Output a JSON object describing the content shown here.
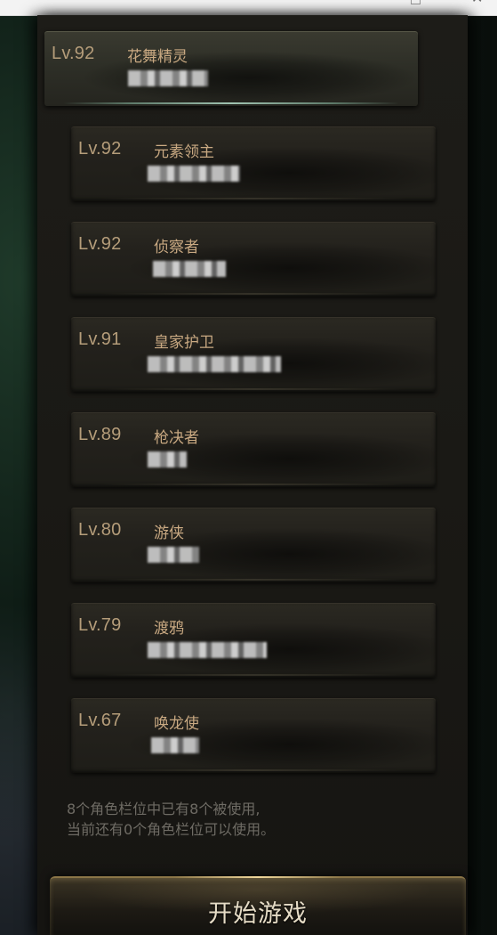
{
  "window": {
    "maximize_icon": "maximize-icon",
    "close_icon": "close-icon",
    "close_glyph": "✕"
  },
  "characters": [
    {
      "level": "Lv.92",
      "class": "花舞精灵"
    },
    {
      "level": "Lv.92",
      "class": "元素领主"
    },
    {
      "level": "Lv.92",
      "class": "侦察者"
    },
    {
      "level": "Lv.91",
      "class": "皇家护卫"
    },
    {
      "level": "Lv.89",
      "class": "枪决者"
    },
    {
      "level": "Lv.80",
      "class": "游侠"
    },
    {
      "level": "Lv.79",
      "class": "渡鸦"
    },
    {
      "level": "Lv.67",
      "class": "唤龙使"
    }
  ],
  "slot_info": {
    "line1": "8个角色栏位中已有8个被使用,",
    "line2": "当前还有0个角色栏位可以使用。"
  },
  "start_button": {
    "label": "开始游戏"
  },
  "colors": {
    "level_text": "#b59d7a",
    "class_text": "#c9a982",
    "info_text": "#6e6b64",
    "selected_glow": "#9fc2b0"
  }
}
